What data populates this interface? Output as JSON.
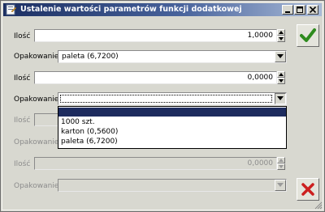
{
  "window": {
    "title": "Ustalenie wartości parametrów funkcji dodatkowej",
    "icons": [
      "app-icon",
      "minimize-icon",
      "maximize-icon",
      "close-icon"
    ]
  },
  "form": {
    "rows": [
      {
        "label": "Ilość",
        "value": "1,0000",
        "enabled": true
      },
      {
        "label": "Opakowanie",
        "value": "paleta (6,7200)",
        "enabled": true
      },
      {
        "label": "Ilość",
        "value": "0,0000",
        "enabled": true
      },
      {
        "label": "Opakowanie",
        "value": "",
        "enabled": true,
        "open": true
      },
      {
        "label": "Ilość",
        "value": "",
        "enabled": false
      },
      {
        "label": "Opakowanie",
        "value": "",
        "enabled": false
      },
      {
        "label": "Ilość",
        "value": "0,0000",
        "enabled": false
      },
      {
        "label": "Opakowanie",
        "value": "",
        "enabled": false
      }
    ]
  },
  "dropdown": {
    "options": [
      "",
      "1000 szt.",
      "karton (0,5600)",
      "paleta (6,7200)"
    ],
    "selected_index": 0
  },
  "buttons": {
    "confirm_icon": "checkmark-icon",
    "cancel_icon": "x-icon",
    "confirm_color": "#2e8b1e",
    "cancel_color": "#cc1f1f"
  }
}
